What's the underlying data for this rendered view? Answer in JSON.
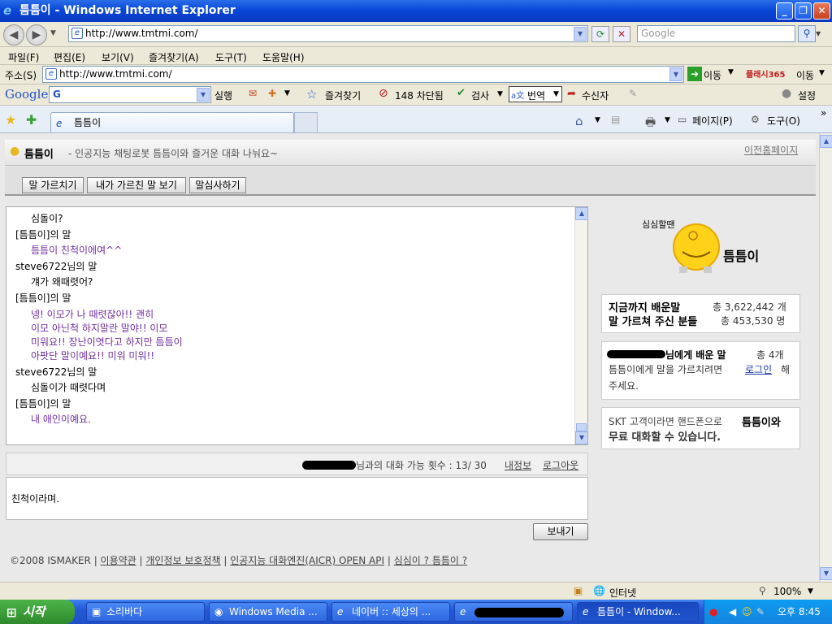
{
  "window": {
    "title": "틈틈이 - Windows Internet Explorer"
  },
  "address": {
    "url": "http://www.tmtmi.com/",
    "search_placeholder": "Google"
  },
  "menu": [
    "파일(F)",
    "편집(E)",
    "보기(V)",
    "즐겨찾기(A)",
    "도구(T)",
    "도움말(H)"
  ],
  "addrbar": {
    "label": "주소(S)",
    "url": "http://www.tmtmi.com/",
    "go": "이동",
    "brand": "플래시365",
    "brand_go": "이동"
  },
  "googlebar": {
    "logo": "Google",
    "g": "G",
    "run": "실행",
    "favorites": "즐겨찾기",
    "blocked": "148 차단됨",
    "check": "검사",
    "translate": "번역",
    "sender": "수신자",
    "settings": "설정"
  },
  "tab": {
    "label": "틈틈이"
  },
  "ietools": {
    "page": "페이지(P)",
    "tools": "도구(O)"
  },
  "site": {
    "logo": "틈틈이",
    "tagline": "- 인공지능 채팅로봇 틈틈이와 즐거운 대화 나눠요~",
    "prev_home": "이전홈페이지",
    "buttons": [
      "말 가르치기",
      "내가 가르친 말 보기",
      "말심사하기"
    ]
  },
  "chat": [
    {
      "text": "심돌이?",
      "style": "user",
      "indent": true
    },
    {
      "text": "[틈틈이]의 말",
      "style": "speaker",
      "indent": false
    },
    {
      "text": "틈틈이 친척이에여^^",
      "style": "bot",
      "indent": true
    },
    {
      "text": "steve6722님의 말",
      "style": "speaker",
      "indent": false
    },
    {
      "text": "걔가 왜때렷어?",
      "style": "user",
      "indent": true
    },
    {
      "text": "[틈틈이]의 말",
      "style": "speaker",
      "indent": false
    },
    {
      "text": "넹! 이모가 나 때렷잖아!! 괜히",
      "style": "bot",
      "indent": true
    },
    {
      "text": "이모 아닌척 하지말란 말야!! 이모",
      "style": "bot",
      "indent": true
    },
    {
      "text": "미워요!! 장난이엿다고 하지만 틈틈이",
      "style": "bot",
      "indent": true
    },
    {
      "text": "아팟단 말이예요!! 미워 미워!!",
      "style": "bot",
      "indent": true
    },
    {
      "text": "steve6722님의 말",
      "style": "speaker",
      "indent": false
    },
    {
      "text": "심돌이가 때렷다며",
      "style": "user",
      "indent": true
    },
    {
      "text": "[틈틈이]의 말",
      "style": "speaker",
      "indent": false
    },
    {
      "text": "내 애인이예요.",
      "style": "bot",
      "indent": true
    }
  ],
  "status": {
    "count_text": "님과의 대화 가능 횟수 : 13/ 30",
    "myinfo": "내정보",
    "logout": "로그아웃"
  },
  "input": {
    "value": "친척이라며."
  },
  "send": "보내기",
  "footer": {
    "copyright": "©2008 ISMAKER",
    "terms": "이용약관",
    "privacy": "개인정보 보호정책",
    "api": "인공지능 대화엔진(AICR) OPEN API",
    "about": "심심이 ? 틈틈이 ?"
  },
  "side": {
    "mascot_caption": "심심할땐",
    "mascot_name": "틈틈이",
    "learned_label": "지금까지 배운말",
    "learned_value": "총 3,622,442 개",
    "teachers_label": "말 가르쳐 주신 분들",
    "teachers_value": "총 453,530 명",
    "personal_line1": "님에게 배운 말",
    "personal_count": "총 4개",
    "personal_line2": "틈틈이에게 말을 가르치려면",
    "login": "로그인",
    "personal_line2_tail": "해",
    "personal_line3": "주세요.",
    "skt_line1": "SKT 고객이라면 핸드폰으로",
    "skt_brand": "틈틈이와",
    "skt_line2": "무료 대화할 수 있습니다."
  },
  "statusbar": {
    "zone": "인터넷",
    "zoom": "100%"
  },
  "taskbar": {
    "start": "시작",
    "items": [
      "소리바다",
      "Windows Media ...",
      "네이버 :: 세상의 ...",
      "",
      "틈틈이 - Window..."
    ],
    "time": "오후 8:45"
  }
}
